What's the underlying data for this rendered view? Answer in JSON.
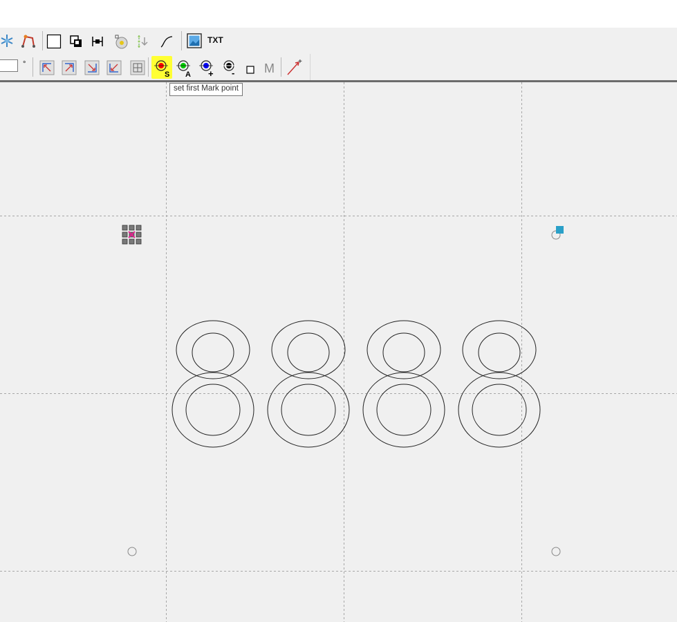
{
  "window": {
    "title": ""
  },
  "toolbar_top": {
    "items": [
      {
        "name": "snowflake-tool-icon",
        "label": ""
      },
      {
        "name": "bend-path-tool-icon",
        "label": ""
      },
      {
        "name": "rectangle-tool-icon",
        "label": ""
      },
      {
        "name": "overlap-tool-icon",
        "label": ""
      },
      {
        "name": "dimension-tool-icon",
        "label": ""
      },
      {
        "name": "disc-tool-icon",
        "label": ""
      },
      {
        "name": "hatch-tool-icon",
        "label": ""
      },
      {
        "name": "curve-tool-icon",
        "label": ""
      },
      {
        "name": "image-tool-icon",
        "label": ""
      }
    ],
    "txt_label": "TXT"
  },
  "toolbar_bottom": {
    "angle_value": "",
    "degree_symbol": "°",
    "items": [
      {
        "name": "align-top-left-icon"
      },
      {
        "name": "align-top-right-icon"
      },
      {
        "name": "align-bottom-right-icon"
      },
      {
        "name": "align-bottom-left-icon"
      },
      {
        "name": "align-center-icon"
      },
      {
        "name": "mark-point-first-icon",
        "sub": "S",
        "color": "#ff0000",
        "active": true
      },
      {
        "name": "mark-point-add-green-icon",
        "sub": "A",
        "color": "#00cc00"
      },
      {
        "name": "mark-point-add-blue-icon",
        "sub": "+",
        "color": "#0000ff"
      },
      {
        "name": "mark-point-remove-icon",
        "sub": "-",
        "color": "#000000"
      },
      {
        "name": "mark-box-icon",
        "label": "M"
      },
      {
        "name": "vector-arrow-icon"
      }
    ]
  },
  "tooltip": {
    "text": "set first Mark point"
  },
  "canvas": {
    "text_object": "8888",
    "highlight_color": "#ffff33",
    "handle_color": "#2aa0c8",
    "grid_line_color": "#a6a6a6",
    "outline_color": "#222222"
  }
}
